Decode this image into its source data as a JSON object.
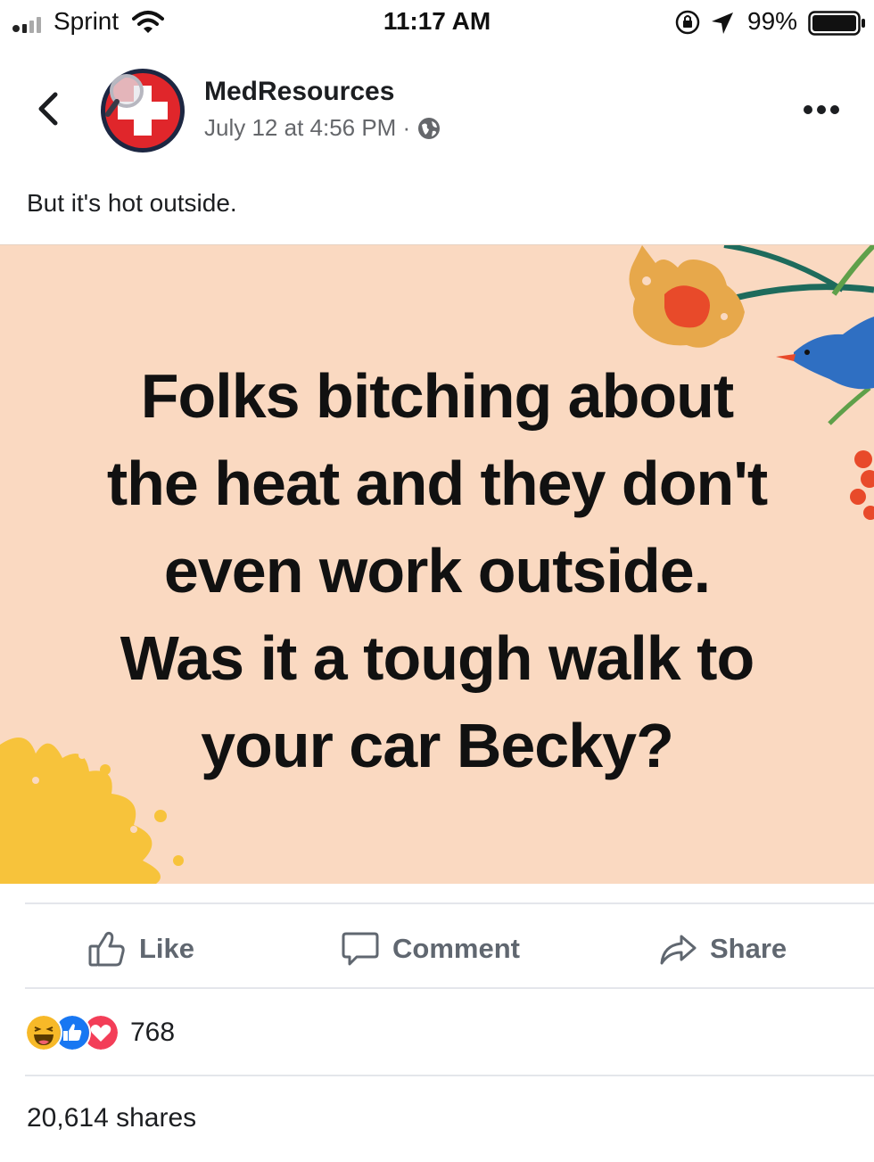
{
  "status_bar": {
    "carrier": "Sprint",
    "time": "11:17 AM",
    "battery_percent": "99%"
  },
  "post": {
    "page_name": "MedResources",
    "timestamp": "July 12 at 4:56 PM ·",
    "caption": "But it's hot outside.",
    "image_text_lines": [
      "Folks bitching about",
      "the heat and they don't",
      "even work outside.",
      "Was it a tough walk to",
      "your car Becky?"
    ]
  },
  "actions": {
    "like_label": "Like",
    "comment_label": "Comment",
    "share_label": "Share"
  },
  "engagement": {
    "reaction_count": "768",
    "shares_text": "20,614 shares"
  },
  "icons": {
    "back": "chevron-left-icon",
    "privacy": "globe-icon",
    "more": "more-dots-icon",
    "like": "thumbs-up-icon",
    "comment": "speech-bubble-icon",
    "share": "share-arrow-icon",
    "reactions": [
      "haha-icon",
      "like-reaction-icon",
      "love-reaction-icon"
    ]
  },
  "colors": {
    "image_background": "#fad9c1",
    "secondary_text": "#65676b",
    "like_blue": "#1877f2",
    "love_red": "#f33e58",
    "haha_yellow": "#f7b928"
  }
}
